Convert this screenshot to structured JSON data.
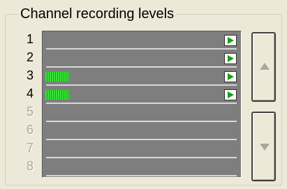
{
  "group": {
    "title": "Channel recording levels"
  },
  "channels": [
    {
      "number": "1",
      "enabled": true,
      "level": 0,
      "play": true
    },
    {
      "number": "2",
      "enabled": true,
      "level": 0,
      "play": true
    },
    {
      "number": "3",
      "enabled": true,
      "level": 0.14,
      "play": true
    },
    {
      "number": "4",
      "enabled": true,
      "level": 0.14,
      "play": true
    },
    {
      "number": "5",
      "enabled": false,
      "level": 0,
      "play": false
    },
    {
      "number": "6",
      "enabled": false,
      "level": 0,
      "play": false
    },
    {
      "number": "7",
      "enabled": false,
      "level": 0,
      "play": false
    },
    {
      "number": "8",
      "enabled": false,
      "level": 0,
      "play": false
    }
  ],
  "icons": {
    "play": "play-icon",
    "scroll_up": "arrow-up-icon",
    "scroll_down": "arrow-down-icon"
  },
  "colors": {
    "meter": "#3ce23c",
    "play_icon": "#14a014",
    "panel": "#7e7e7e",
    "disabled_text": "#aca899"
  },
  "scroll": {
    "up_enabled": false,
    "down_enabled": false
  }
}
